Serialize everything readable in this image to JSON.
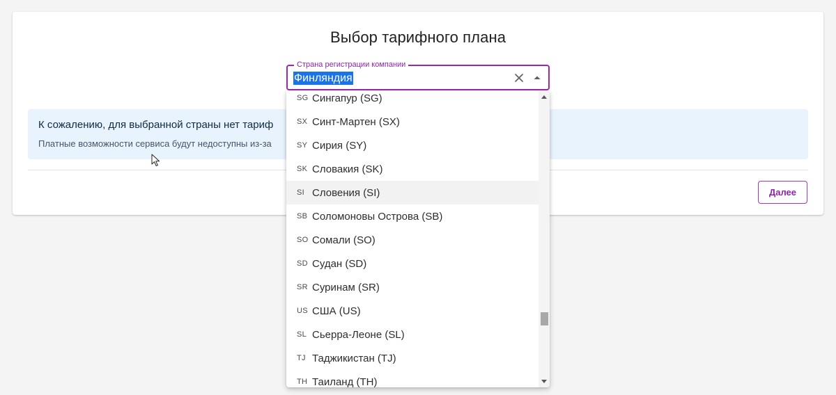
{
  "page": {
    "title": "Выбор тарифного плана"
  },
  "country_field": {
    "label": "Страна регистрации компании",
    "value": "Финляндия"
  },
  "icons": {
    "clear": "close-icon",
    "popup": "arrow-drop-up-icon",
    "cursor": "mouse-pointer-icon"
  },
  "alert": {
    "title": "К сожалению, для выбранной страны нет тариф",
    "text": "Платные возможности сервиса будут недоступны из-за"
  },
  "next_button": {
    "label": "Далее"
  },
  "country_options": [
    {
      "code": "SG",
      "name": "Сингапур (SG)"
    },
    {
      "code": "SX",
      "name": "Синт-Мартен (SX)"
    },
    {
      "code": "SY",
      "name": "Сирия (SY)"
    },
    {
      "code": "SK",
      "name": "Словакия (SK)"
    },
    {
      "code": "SI",
      "name": "Словения (SI)"
    },
    {
      "code": "SB",
      "name": "Соломоновы Острова (SB)"
    },
    {
      "code": "SO",
      "name": "Сомали (SO)"
    },
    {
      "code": "SD",
      "name": "Судан (SD)"
    },
    {
      "code": "SR",
      "name": "Суринам (SR)"
    },
    {
      "code": "US",
      "name": "США (US)"
    },
    {
      "code": "SL",
      "name": "Сьерра-Леоне (SL)"
    },
    {
      "code": "TJ",
      "name": "Таджикистан (TJ)"
    },
    {
      "code": "TH",
      "name": "Таиланд (TH)"
    }
  ],
  "hovered_option_index": 4,
  "colors": {
    "accent": "#9c27b0",
    "selection": "#1a73e8",
    "alert_background": "#e8f3fd"
  }
}
